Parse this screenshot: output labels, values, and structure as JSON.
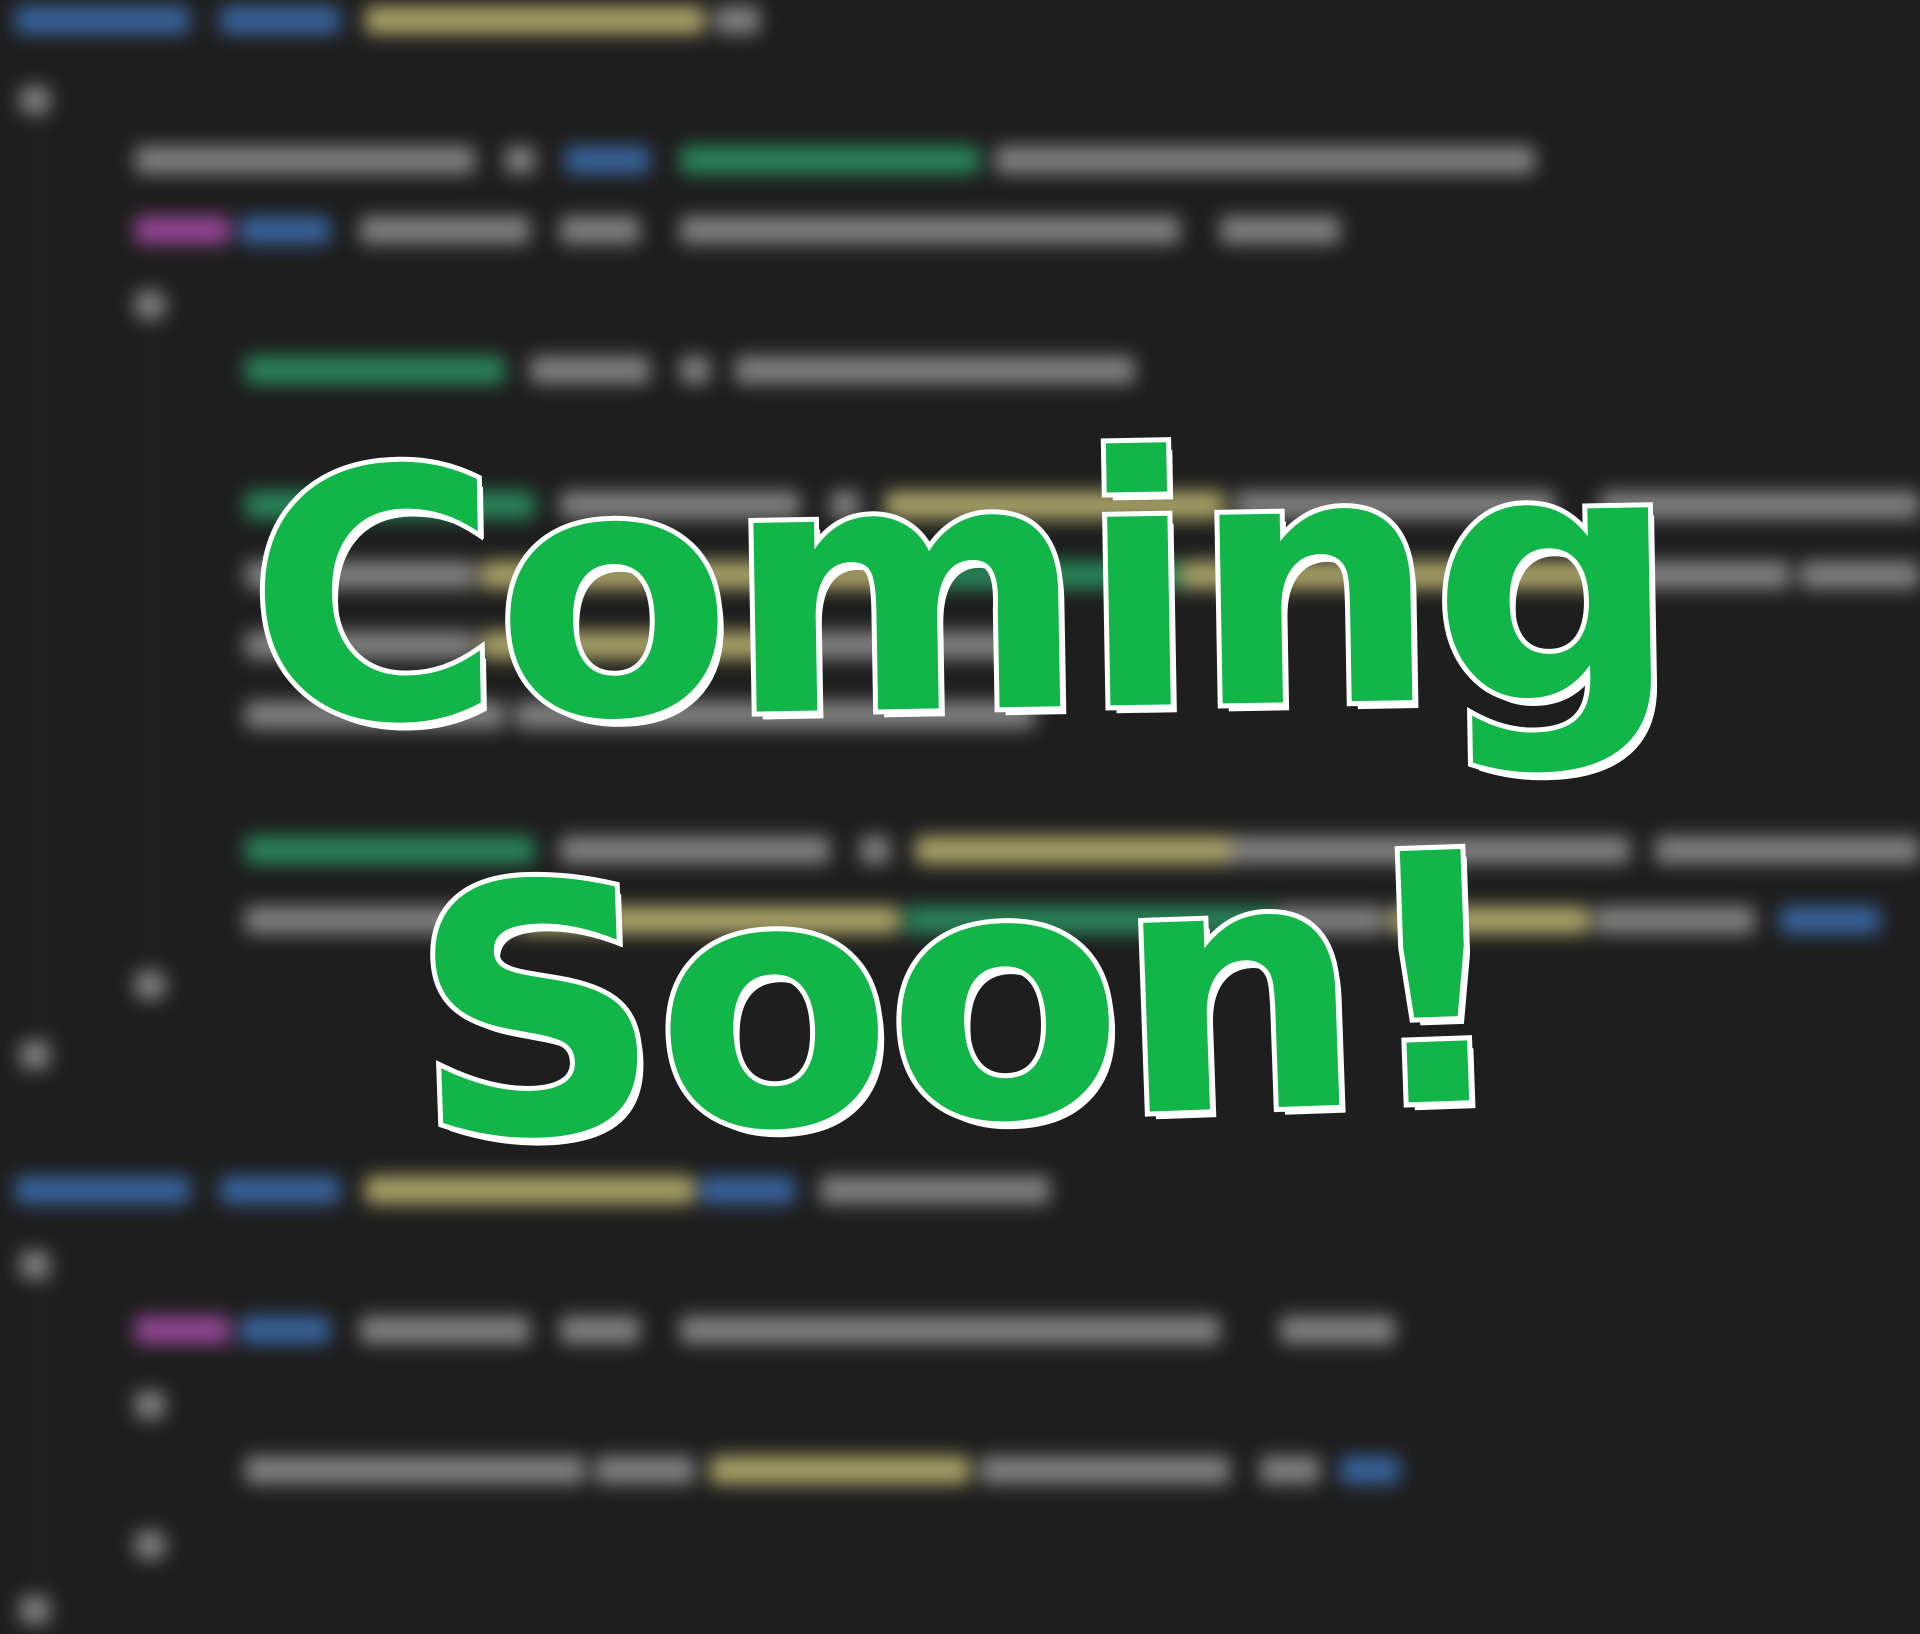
{
  "headline": {
    "line1": "Coming",
    "line2": "Soon!"
  },
  "colors": {
    "background": "#1e1e1e",
    "headline_fill": "#12b548",
    "headline_outline": "#ffffff",
    "code_keyword": "#3b6aa8",
    "code_type": "#2a8f5e",
    "code_identifier": "#8a8a8a",
    "code_method": "#b8b070",
    "code_control": "#a04aa0"
  }
}
